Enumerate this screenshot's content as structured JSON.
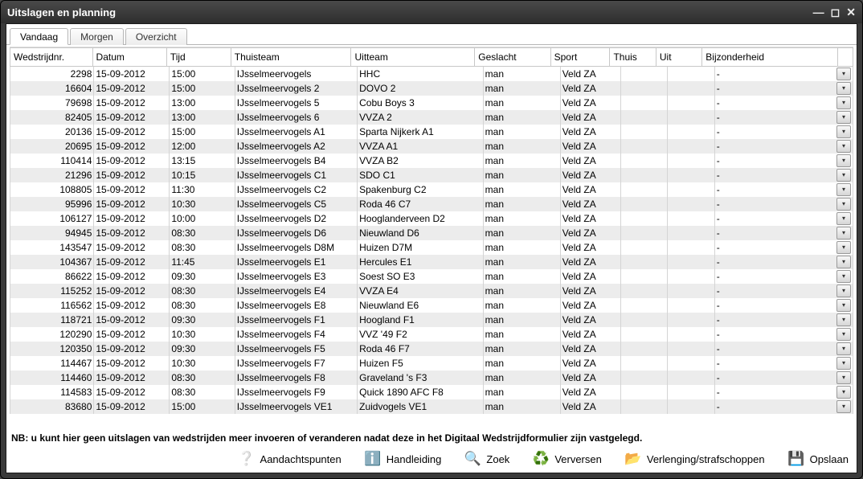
{
  "window": {
    "title": "Uitslagen en planning"
  },
  "tabs": [
    {
      "label": "Vandaag",
      "active": true
    },
    {
      "label": "Morgen",
      "active": false
    },
    {
      "label": "Overzicht",
      "active": false
    }
  ],
  "columns": [
    "Wedstrijdnr.",
    "Datum",
    "Tijd",
    "Thuisteam",
    "Uitteam",
    "Geslacht",
    "Sport",
    "Thuis",
    "Uit",
    "Bijzonderheid"
  ],
  "rows": [
    {
      "nr": "2298",
      "datum": "15-09-2012",
      "tijd": "15:00",
      "thuisteam": "IJsselmeervogels",
      "uitteam": "HHC",
      "geslacht": "man",
      "sport": "Veld ZA",
      "thuis": "",
      "uit": "",
      "bij": "-"
    },
    {
      "nr": "16604",
      "datum": "15-09-2012",
      "tijd": "15:00",
      "thuisteam": "IJsselmeervogels 2",
      "uitteam": "DOVO 2",
      "geslacht": "man",
      "sport": "Veld ZA",
      "thuis": "",
      "uit": "",
      "bij": "-"
    },
    {
      "nr": "79698",
      "datum": "15-09-2012",
      "tijd": "13:00",
      "thuisteam": "IJsselmeervogels 5",
      "uitteam": "Cobu Boys 3",
      "geslacht": "man",
      "sport": "Veld ZA",
      "thuis": "",
      "uit": "",
      "bij": "-"
    },
    {
      "nr": "82405",
      "datum": "15-09-2012",
      "tijd": "13:00",
      "thuisteam": "IJsselmeervogels 6",
      "uitteam": "VVZA 2",
      "geslacht": "man",
      "sport": "Veld ZA",
      "thuis": "",
      "uit": "",
      "bij": "-"
    },
    {
      "nr": "20136",
      "datum": "15-09-2012",
      "tijd": "15:00",
      "thuisteam": "IJsselmeervogels A1",
      "uitteam": "Sparta Nijkerk A1",
      "geslacht": "man",
      "sport": "Veld ZA",
      "thuis": "",
      "uit": "",
      "bij": "-"
    },
    {
      "nr": "20695",
      "datum": "15-09-2012",
      "tijd": "12:00",
      "thuisteam": "IJsselmeervogels A2",
      "uitteam": "VVZA A1",
      "geslacht": "man",
      "sport": "Veld ZA",
      "thuis": "",
      "uit": "",
      "bij": "-"
    },
    {
      "nr": "110414",
      "datum": "15-09-2012",
      "tijd": "13:15",
      "thuisteam": "IJsselmeervogels B4",
      "uitteam": "VVZA B2",
      "geslacht": "man",
      "sport": "Veld ZA",
      "thuis": "",
      "uit": "",
      "bij": "-"
    },
    {
      "nr": "21296",
      "datum": "15-09-2012",
      "tijd": "10:15",
      "thuisteam": "IJsselmeervogels C1",
      "uitteam": "SDO C1",
      "geslacht": "man",
      "sport": "Veld ZA",
      "thuis": "",
      "uit": "",
      "bij": "-"
    },
    {
      "nr": "108805",
      "datum": "15-09-2012",
      "tijd": "11:30",
      "thuisteam": "IJsselmeervogels C2",
      "uitteam": "Spakenburg C2",
      "geslacht": "man",
      "sport": "Veld ZA",
      "thuis": "",
      "uit": "",
      "bij": "-"
    },
    {
      "nr": "95996",
      "datum": "15-09-2012",
      "tijd": "10:30",
      "thuisteam": "IJsselmeervogels C5",
      "uitteam": "Roda 46 C7",
      "geslacht": "man",
      "sport": "Veld ZA",
      "thuis": "",
      "uit": "",
      "bij": "-"
    },
    {
      "nr": "106127",
      "datum": "15-09-2012",
      "tijd": "10:00",
      "thuisteam": "IJsselmeervogels D2",
      "uitteam": "Hooglanderveen D2",
      "geslacht": "man",
      "sport": "Veld ZA",
      "thuis": "",
      "uit": "",
      "bij": "-"
    },
    {
      "nr": "94945",
      "datum": "15-09-2012",
      "tijd": "08:30",
      "thuisteam": "IJsselmeervogels D6",
      "uitteam": "Nieuwland D6",
      "geslacht": "man",
      "sport": "Veld ZA",
      "thuis": "",
      "uit": "",
      "bij": "-"
    },
    {
      "nr": "143547",
      "datum": "15-09-2012",
      "tijd": "08:30",
      "thuisteam": "IJsselmeervogels D8M",
      "uitteam": "Huizen D7M",
      "geslacht": "man",
      "sport": "Veld ZA",
      "thuis": "",
      "uit": "",
      "bij": "-"
    },
    {
      "nr": "104367",
      "datum": "15-09-2012",
      "tijd": "11:45",
      "thuisteam": "IJsselmeervogels E1",
      "uitteam": "Hercules E1",
      "geslacht": "man",
      "sport": "Veld ZA",
      "thuis": "",
      "uit": "",
      "bij": "-"
    },
    {
      "nr": "86622",
      "datum": "15-09-2012",
      "tijd": "09:30",
      "thuisteam": "IJsselmeervogels E3",
      "uitteam": "Soest SO E3",
      "geslacht": "man",
      "sport": "Veld ZA",
      "thuis": "",
      "uit": "",
      "bij": "-"
    },
    {
      "nr": "115252",
      "datum": "15-09-2012",
      "tijd": "08:30",
      "thuisteam": "IJsselmeervogels E4",
      "uitteam": "VVZA E4",
      "geslacht": "man",
      "sport": "Veld ZA",
      "thuis": "",
      "uit": "",
      "bij": "-"
    },
    {
      "nr": "116562",
      "datum": "15-09-2012",
      "tijd": "08:30",
      "thuisteam": "IJsselmeervogels E8",
      "uitteam": "Nieuwland E6",
      "geslacht": "man",
      "sport": "Veld ZA",
      "thuis": "",
      "uit": "",
      "bij": "-"
    },
    {
      "nr": "118721",
      "datum": "15-09-2012",
      "tijd": "09:30",
      "thuisteam": "IJsselmeervogels F1",
      "uitteam": "Hoogland F1",
      "geslacht": "man",
      "sport": "Veld ZA",
      "thuis": "",
      "uit": "",
      "bij": "-"
    },
    {
      "nr": "120290",
      "datum": "15-09-2012",
      "tijd": "10:30",
      "thuisteam": "IJsselmeervogels F4",
      "uitteam": "VVZ '49 F2",
      "geslacht": "man",
      "sport": "Veld ZA",
      "thuis": "",
      "uit": "",
      "bij": "-"
    },
    {
      "nr": "120350",
      "datum": "15-09-2012",
      "tijd": "09:30",
      "thuisteam": "IJsselmeervogels F5",
      "uitteam": "Roda 46 F7",
      "geslacht": "man",
      "sport": "Veld ZA",
      "thuis": "",
      "uit": "",
      "bij": "-"
    },
    {
      "nr": "114467",
      "datum": "15-09-2012",
      "tijd": "10:30",
      "thuisteam": "IJsselmeervogels F7",
      "uitteam": "Huizen F5",
      "geslacht": "man",
      "sport": "Veld ZA",
      "thuis": "",
      "uit": "",
      "bij": "-"
    },
    {
      "nr": "114460",
      "datum": "15-09-2012",
      "tijd": "08:30",
      "thuisteam": "IJsselmeervogels F8",
      "uitteam": "Graveland 's F3",
      "geslacht": "man",
      "sport": "Veld ZA",
      "thuis": "",
      "uit": "",
      "bij": "-"
    },
    {
      "nr": "114583",
      "datum": "15-09-2012",
      "tijd": "08:30",
      "thuisteam": "IJsselmeervogels F9",
      "uitteam": "Quick 1890 AFC F8",
      "geslacht": "man",
      "sport": "Veld ZA",
      "thuis": "",
      "uit": "",
      "bij": "-"
    },
    {
      "nr": "83680",
      "datum": "15-09-2012",
      "tijd": "15:00",
      "thuisteam": "IJsselmeervogels VE1",
      "uitteam": "Zuidvogels VE1",
      "geslacht": "man",
      "sport": "Veld ZA",
      "thuis": "",
      "uit": "",
      "bij": "-"
    }
  ],
  "note": "NB: u kunt hier geen uitslagen van wedstrijden meer invoeren of veranderen nadat deze in het Digitaal Wedstrijdformulier zijn vastgelegd.",
  "toolbar": {
    "aandachtspunten": "Aandachtspunten",
    "handleiding": "Handleiding",
    "zoek": "Zoek",
    "verversen": "Verversen",
    "verlenging": "Verlenging/strafschoppen",
    "opslaan": "Opslaan"
  }
}
